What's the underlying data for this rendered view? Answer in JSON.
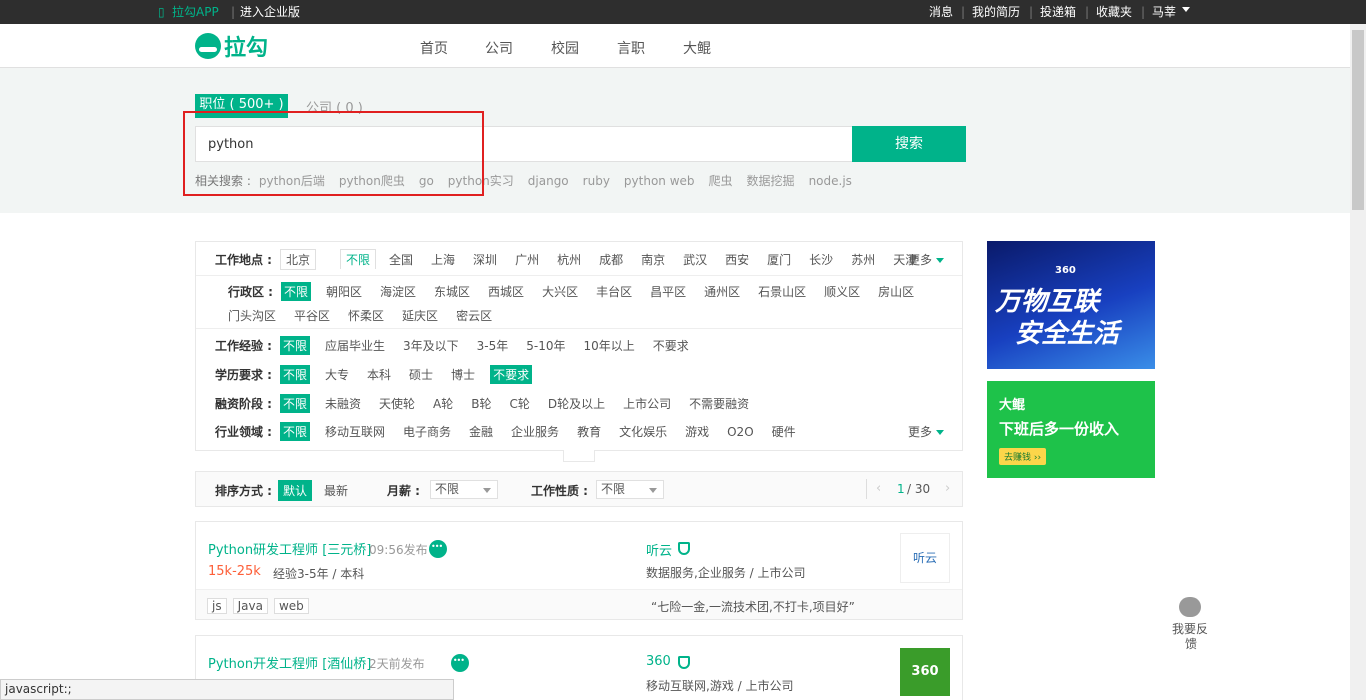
{
  "topbar": {
    "app_link": "拉勾APP",
    "enterprise_link": "进入企业版",
    "messages": "消息",
    "resume": "我的简历",
    "delivery": "投递箱",
    "favorites": "收藏夹",
    "user": "马莘"
  },
  "header": {
    "logo_text": "拉勾",
    "nav": [
      "首页",
      "公司",
      "校园",
      "言职",
      "大鲲"
    ]
  },
  "search": {
    "tab_jobs": "职位 ( 500+ )",
    "tab_company": "公司 ( 0 )",
    "value": "python",
    "button": "搜索",
    "related_label": "相关搜索 :",
    "related": [
      "python后端",
      "python爬虫",
      "go",
      "python实习",
      "django",
      "ruby",
      "python web",
      "爬虫",
      "数据挖掘",
      "node.js"
    ]
  },
  "filters": {
    "location_label": "工作地点 :",
    "current_city": "北京",
    "cities": [
      "不限",
      "全国",
      "上海",
      "深圳",
      "广州",
      "杭州",
      "成都",
      "南京",
      "武汉",
      "西安",
      "厦门",
      "长沙",
      "苏州",
      "天津"
    ],
    "more": "更多",
    "district_label": "行政区 :",
    "districts_row1": [
      "不限",
      "朝阳区",
      "海淀区",
      "东城区",
      "西城区",
      "大兴区",
      "丰台区",
      "昌平区",
      "通州区",
      "石景山区",
      "顺义区",
      "房山区"
    ],
    "districts_row2": [
      "门头沟区",
      "平谷区",
      "怀柔区",
      "延庆区",
      "密云区"
    ],
    "experience_label": "工作经验 :",
    "experience": [
      "不限",
      "应届毕业生",
      "3年及以下",
      "3-5年",
      "5-10年",
      "10年以上",
      "不要求"
    ],
    "education_label": "学历要求 :",
    "education": [
      "不限",
      "大专",
      "本科",
      "硕士",
      "博士",
      "不要求"
    ],
    "funding_label": "融资阶段 :",
    "funding": [
      "不限",
      "未融资",
      "天使轮",
      "A轮",
      "B轮",
      "C轮",
      "D轮及以上",
      "上市公司",
      "不需要融资"
    ],
    "industry_label": "行业领域 :",
    "industry": [
      "不限",
      "移动互联网",
      "电子商务",
      "金融",
      "企业服务",
      "教育",
      "文化娱乐",
      "游戏",
      "O2O",
      "硬件"
    ],
    "industry_more": "更多"
  },
  "sort": {
    "label": "排序方式 :",
    "default": "默认",
    "latest": "最新",
    "salary_label": "月薪 :",
    "salary_value": "不限",
    "nature_label": "工作性质 :",
    "nature_value": "不限",
    "page_current": "1",
    "page_total": "/ 30"
  },
  "jobs": [
    {
      "title": "Python研发工程师 [三元桥]",
      "time": "09:56发布",
      "salary": "15k-25k",
      "requirements": "经验3-5年 / 本科",
      "company": "听云",
      "company_info": "数据服务,企业服务 / 上市公司",
      "logo_text": "听云",
      "tags": [
        "js",
        "Java",
        "web"
      ],
      "benefits": "“七险一金,一流技术团,不打卡,项目好”"
    },
    {
      "title": "Python开发工程师 [酒仙桥]",
      "time": "2天前发布",
      "company": "360",
      "company_info": "移动互联网,游戏 / 上市公司",
      "logo_text": "360"
    }
  ],
  "ads": {
    "ad1_brand": "360",
    "ad1_line1": "万物互联",
    "ad1_line2": "安全生活",
    "ad2_brand": "大鲲",
    "ad2_title": "下班后多一份收入",
    "ad2_button": "去赚钱 ››"
  },
  "feedback": {
    "line1": "我要反",
    "line2": "馈"
  },
  "statusbar": "javascript:;"
}
